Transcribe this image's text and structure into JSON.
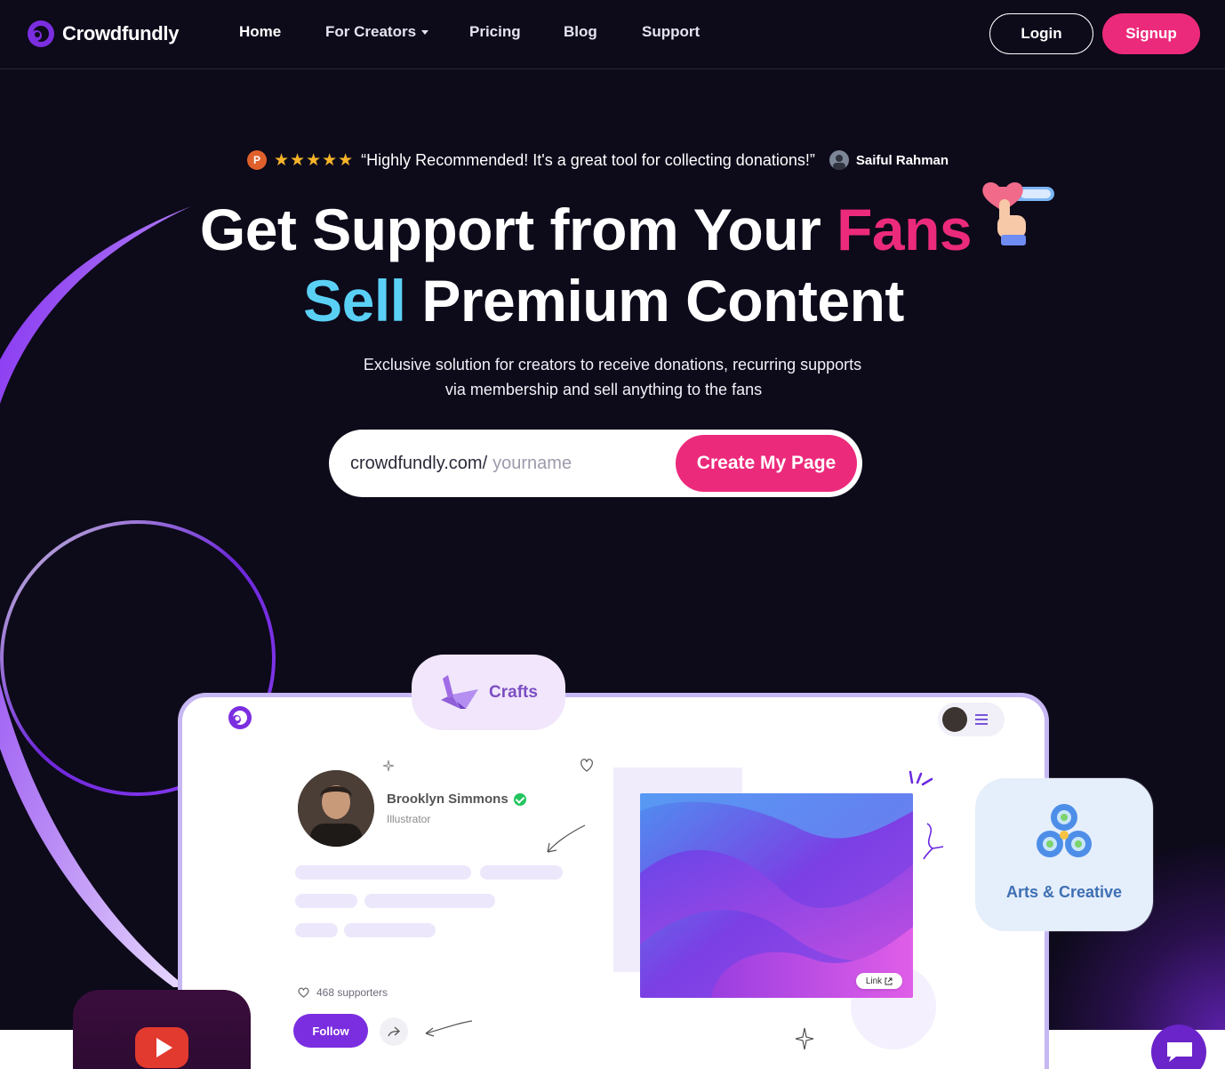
{
  "brand": {
    "name": "Crowdfundly",
    "accent": "#ec2a7b",
    "purple": "#7b2ee0"
  },
  "nav": {
    "items": [
      {
        "label": "Home"
      },
      {
        "label": "For Creators"
      },
      {
        "label": "Pricing"
      },
      {
        "label": "Blog"
      },
      {
        "label": "Support"
      }
    ],
    "login_label": "Login",
    "signup_label": "Signup"
  },
  "review": {
    "badge": "P",
    "stars": "★★★★★",
    "rating": 5,
    "quote": "“Highly Recommended! It's a great tool for collecting donations!”",
    "author": "Saiful Rahman"
  },
  "hero": {
    "line1_prefix": "Get Support from Your",
    "line1_highlight": "Fans",
    "line2_highlight": "Sell",
    "line2_suffix": "Premium Content",
    "subtitle_line1": "Exclusive solution for creators to receive donations, recurring supports",
    "subtitle_line2": "via membership and sell anything to the fans"
  },
  "signup_form": {
    "prefix": "crowdfundly.com/",
    "placeholder": "yourname",
    "button_label": "Create My Page"
  },
  "mock_profile": {
    "name": "Brooklyn Simmons",
    "role": "Illustrator",
    "supporters": "468 supporters",
    "follow_label": "Follow",
    "link_label": "Link"
  },
  "chips": {
    "crafts": "Crafts",
    "arts": "Arts & Creative"
  }
}
